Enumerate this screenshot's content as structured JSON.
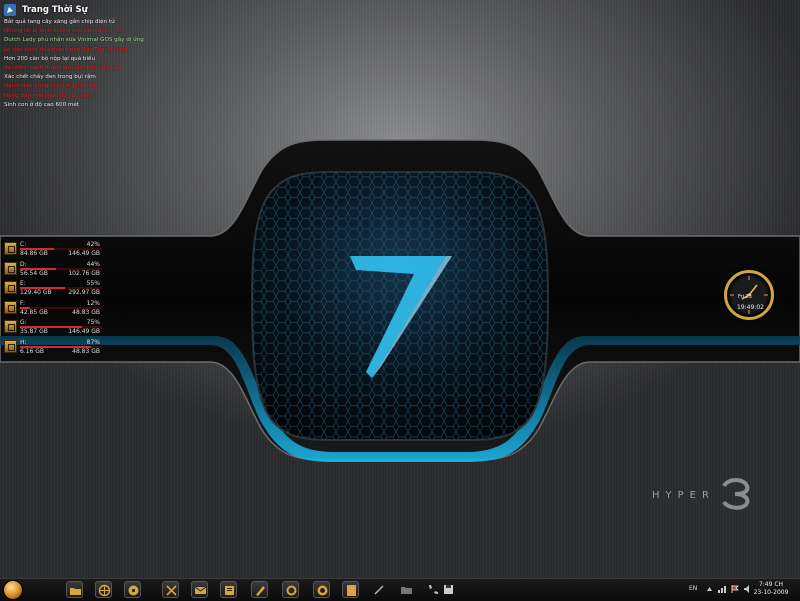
{
  "news": {
    "title": "Trang Thời Sự",
    "items": [
      {
        "text": "Bắt quả tang cây xăng gắn chip điện tử",
        "color": "white"
      },
      {
        "text": "Những lời bị lãnh chứng chứ kiến đi lịch cổ",
        "color": "red"
      },
      {
        "text": "Dutch Lady phủ nhận sữa Vinimal GOS gây dị ứng",
        "color": "green"
      },
      {
        "text": "Lộ dân cuộc đua thành phố Bắc Thăng Long",
        "color": "red"
      },
      {
        "text": "Hơn 200 căn bộ nộp lại quà biếu",
        "color": "white"
      },
      {
        "text": "Xã chính sách thực hiện cam kết lĩnh vực",
        "color": "red"
      },
      {
        "text": "Xác chết cháy đen trong bụi rậm",
        "color": "white"
      },
      {
        "text": "Người dân vùng lũ bỏ đi phố biển",
        "color": "red"
      },
      {
        "text": "Nông dân mất mùa do sâu bệnh",
        "color": "red"
      },
      {
        "text": "Sinh con ở độ cao 600 mét",
        "color": "white"
      }
    ]
  },
  "drives": [
    {
      "letter": "C:",
      "percent": "42%",
      "fill": 0.42,
      "used": "84.86 GB",
      "total": "146.49 GB"
    },
    {
      "letter": "D:",
      "percent": "44%",
      "fill": 0.44,
      "used": "56.54 GB",
      "total": "102.76 GB"
    },
    {
      "letter": "E:",
      "percent": "55%",
      "fill": 0.55,
      "used": "129.40 GB",
      "total": "292.97 GB"
    },
    {
      "letter": "F:",
      "percent": "12%",
      "fill": 0.12,
      "used": "42.85 GB",
      "total": "48.83 GB"
    },
    {
      "letter": "G:",
      "percent": "75%",
      "fill": 0.75,
      "used": "35.87 GB",
      "total": "146.49 GB"
    },
    {
      "letter": "H:",
      "percent": "87%",
      "fill": 0.87,
      "used": "6.16 GB",
      "total": "48.83 GB"
    }
  ],
  "clock": {
    "date": "Fri 23",
    "time": "19:49:02"
  },
  "branding": {
    "logo_text": "HYPER"
  },
  "taskbar": {
    "buttons": [
      "orb",
      "folder",
      "browser",
      "media",
      "tools",
      "mail",
      "files",
      "pen",
      "settings",
      "globe",
      "notes",
      "pen2",
      "explorer",
      "phone",
      "save"
    ],
    "language": "EN",
    "time": "7:49 CH",
    "date": "23-10-2009"
  },
  "colors": {
    "accent": "#2fb9e8",
    "gold": "#d2a63f",
    "bar_red": "#d32a2a",
    "news_red": "#e32a2a",
    "news_green": "#9fe59a"
  }
}
